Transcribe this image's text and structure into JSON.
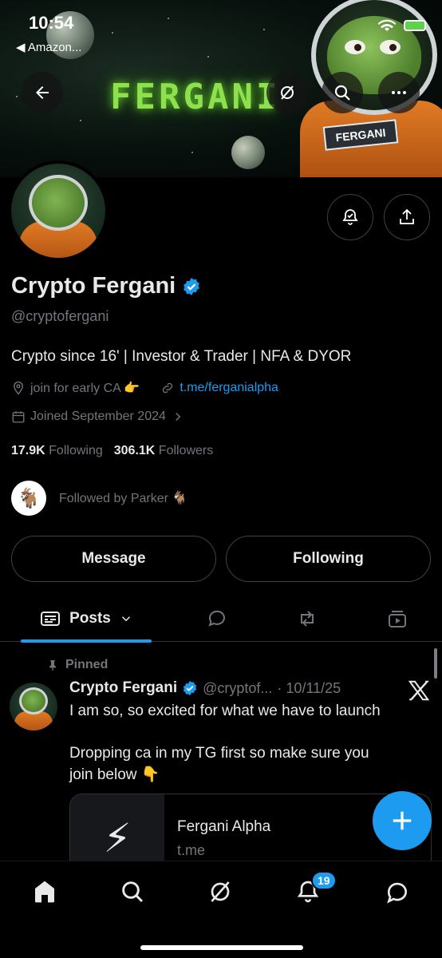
{
  "status_bar": {
    "time": "10:54",
    "back_app": "◀ Amazon..."
  },
  "banner": {
    "word": "FERGANI",
    "patch_text": "FERGANI"
  },
  "profile": {
    "name": "Crypto Fergani",
    "handle": "@cryptofergani",
    "bio": "Crypto since 16' | Investor & Trader | NFA & DYOR",
    "location": "join for early CA 👉",
    "link": "t.me/ferganialpha",
    "joined": "Joined September 2024",
    "following_count": "17.9K",
    "following_label": "Following",
    "followers_count": "306.1K",
    "followers_label": "Followers",
    "followed_by": "Followed by Parker 🐐",
    "followed_by_avatar": "🐐"
  },
  "buttons": {
    "message": "Message",
    "following": "Following"
  },
  "tabs": {
    "posts": "Posts"
  },
  "post": {
    "pinned_label": "Pinned",
    "author": "Crypto Fergani",
    "handle": "@cryptof...",
    "date": "· 10/11/25",
    "line1": "I am so, so excited for what we have to launch",
    "line2": "Dropping ca in my TG first so make sure you",
    "line3": "join below 👇",
    "card_title": "Fergani Alpha",
    "card_domain": "t.me",
    "card_thumb": "⚡"
  },
  "nav": {
    "notification_badge": "19"
  },
  "colors": {
    "accent": "#1d9bf0",
    "muted": "#71767b",
    "background": "#000000",
    "text": "#e7e9ea"
  }
}
